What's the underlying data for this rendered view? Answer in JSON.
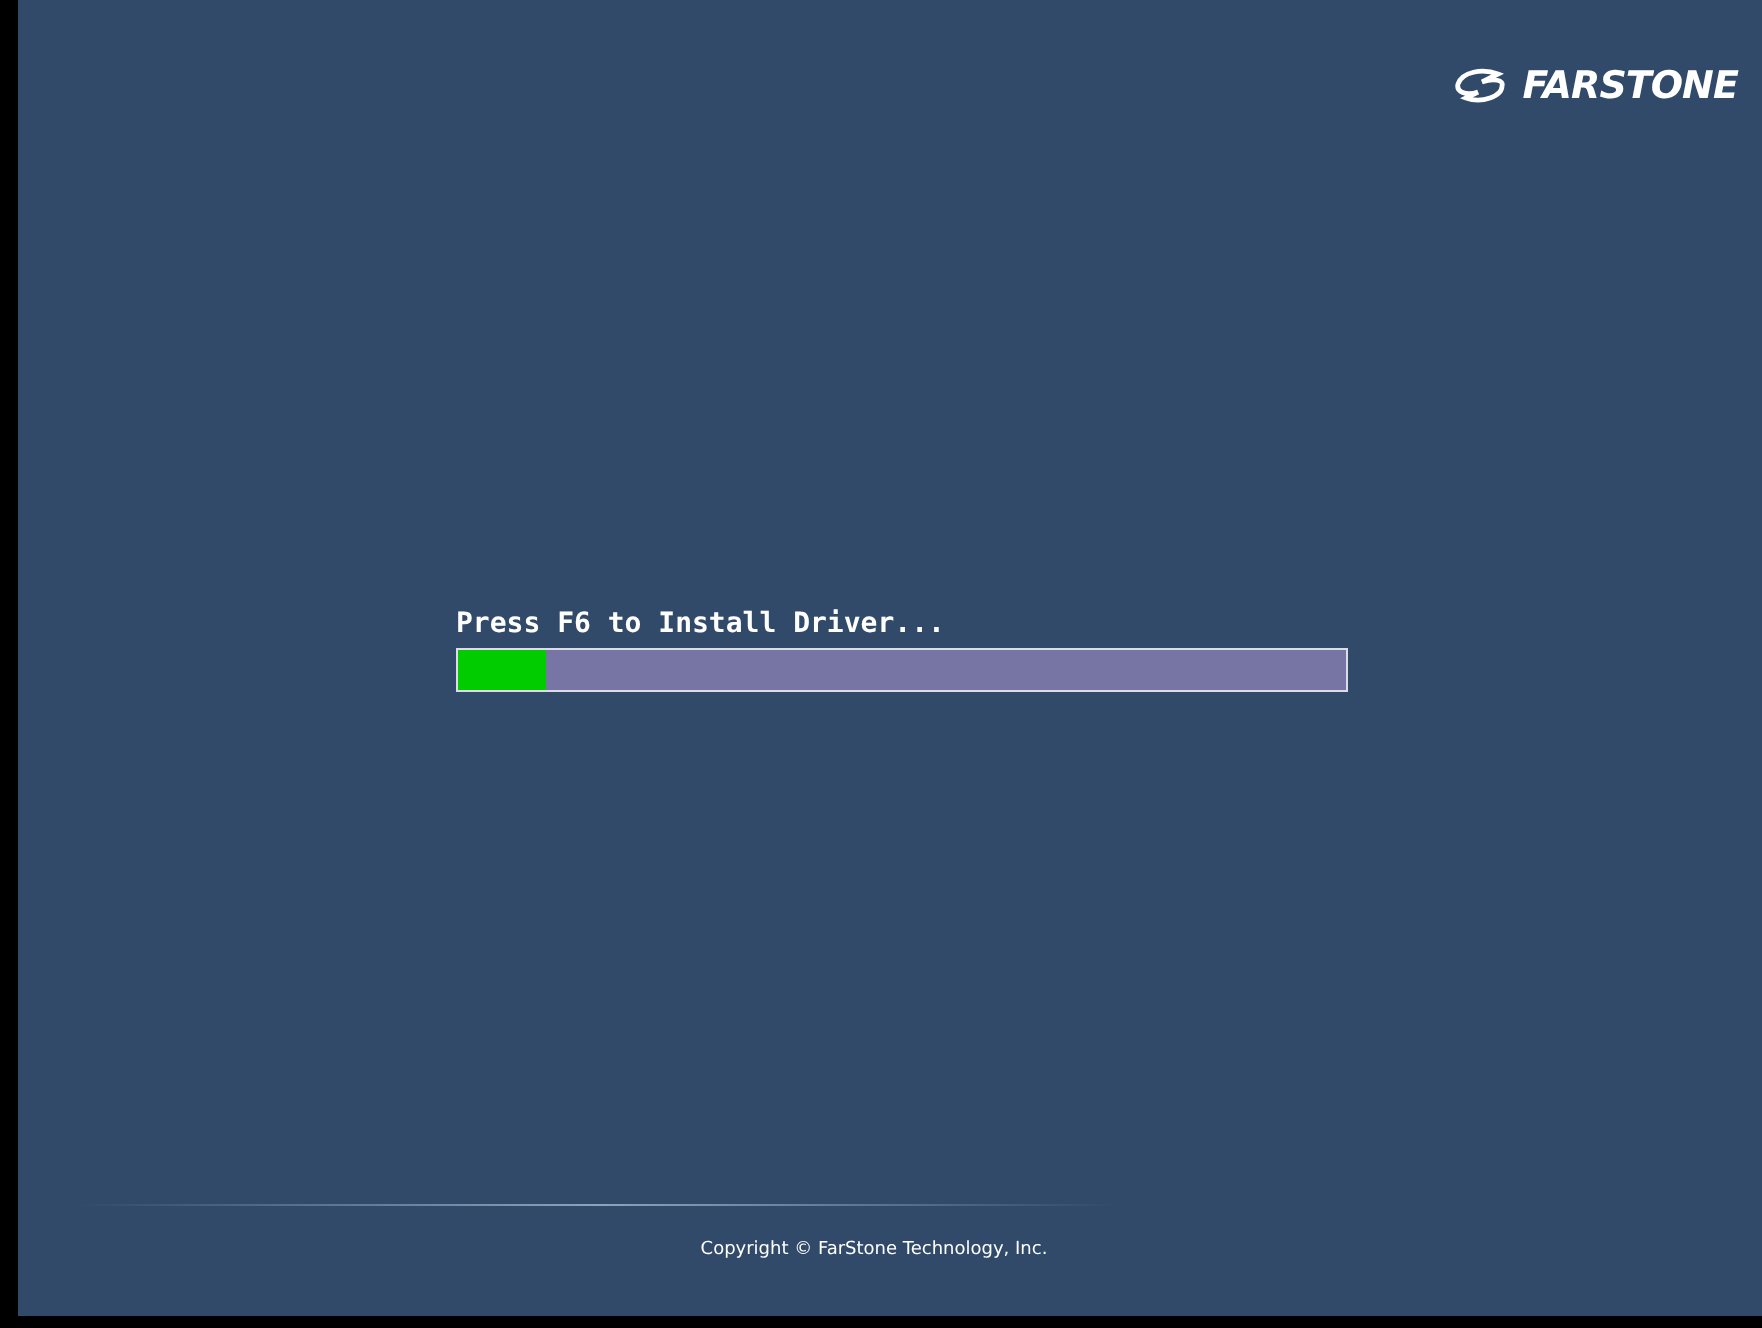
{
  "logo": {
    "text": "FARSTONE"
  },
  "loader": {
    "message": "Press F6 to Install Driver...",
    "level": 0.1
  },
  "footer": {
    "copyright": "Copyright © FarStone Technology, Inc."
  }
}
